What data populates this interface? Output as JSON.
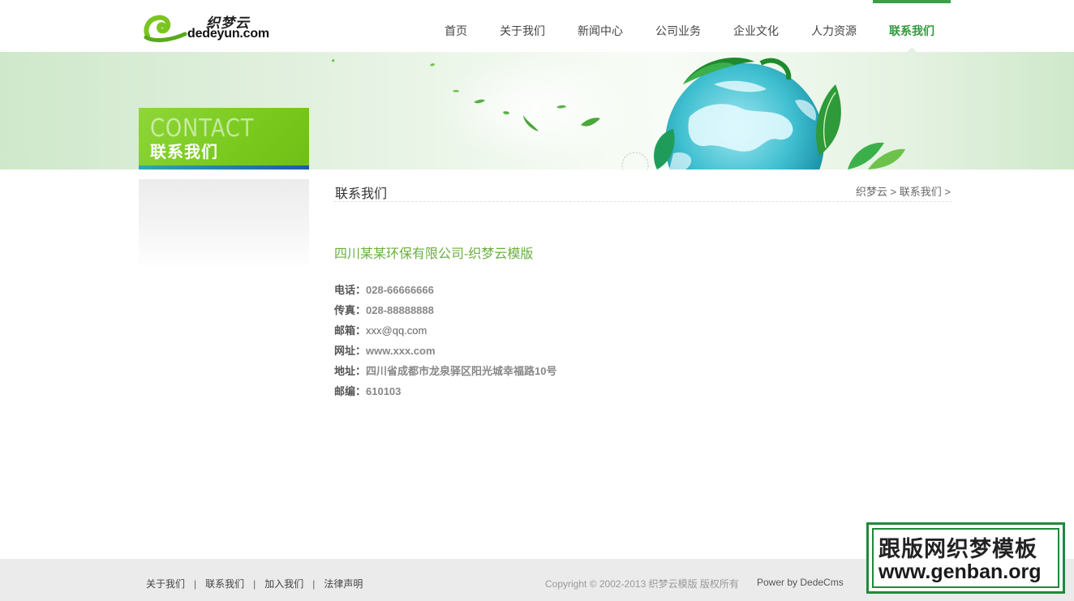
{
  "brand": {
    "name_cn": "织梦云",
    "name_en": "dedeyun.com"
  },
  "nav": {
    "items": [
      {
        "label": "首页"
      },
      {
        "label": "关于我们"
      },
      {
        "label": "新闻中心"
      },
      {
        "label": "公司业务"
      },
      {
        "label": "企业文化"
      },
      {
        "label": "人力资源"
      },
      {
        "label": "联系我们"
      }
    ],
    "active_index": 6
  },
  "banner": {
    "title_en": "CONTACT",
    "title_cn": "联系我们"
  },
  "main": {
    "title": "联系我们",
    "breadcrumb": {
      "home": "织梦云",
      "sep1": " > ",
      "current": "联系我们",
      "sep2": " >"
    },
    "company": "四川某某环保有限公司-织梦云模版",
    "contacts": [
      {
        "key": "电话：",
        "value": "028-66666666"
      },
      {
        "key": "传真：",
        "value": "028-88888888"
      },
      {
        "key": "邮箱：",
        "value": "xxx@qq.com"
      },
      {
        "key": "网址：",
        "value": "www.xxx.com"
      },
      {
        "key": "地址：",
        "value": "四川省成都市龙泉驿区阳光城幸福路10号"
      },
      {
        "key": "邮编：",
        "value": "610103"
      }
    ]
  },
  "footer": {
    "links": [
      {
        "label": "关于我们"
      },
      {
        "label": "联系我们"
      },
      {
        "label": "加入我们"
      },
      {
        "label": "法律声明"
      }
    ],
    "separator": "|",
    "copyright": "Copyright © 2002-2013 织梦云模版 版权所有",
    "powered": "Power by DedeCms"
  },
  "watermark": {
    "line1": "跟版网织梦模板",
    "line2": "www.genban.org"
  },
  "colors": {
    "accent_green": "#3aa14a",
    "company_green": "#6aaf3d",
    "badge_green": "#79c91d",
    "footer_bg": "#ebebeb"
  }
}
